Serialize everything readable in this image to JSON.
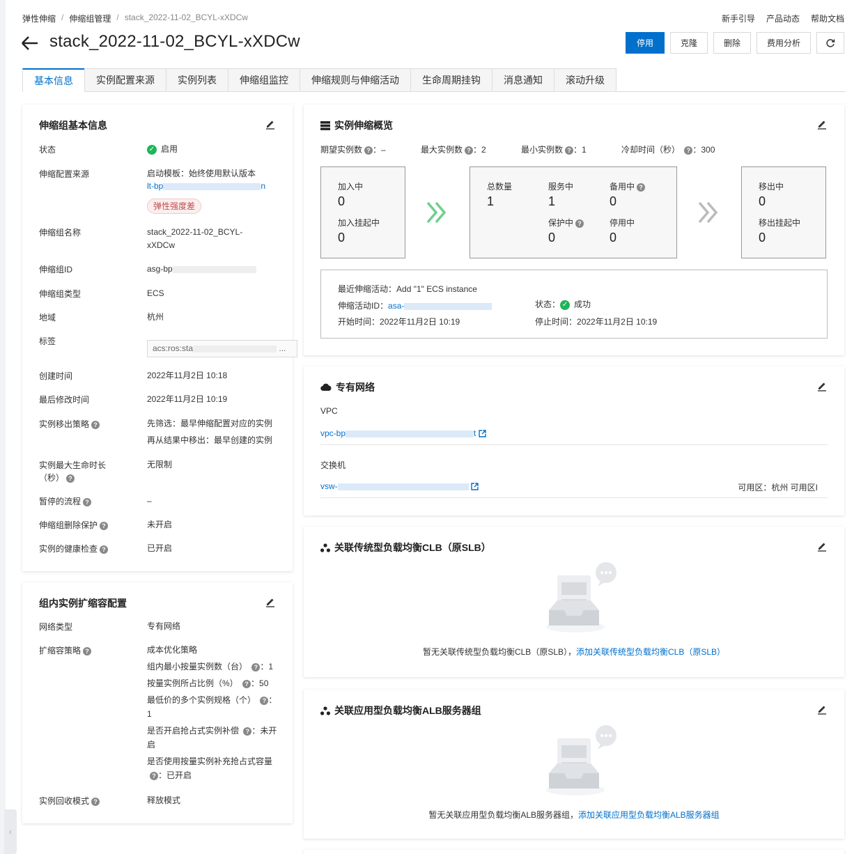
{
  "breadcrumb": {
    "items": [
      "弹性伸缩",
      "伸缩组管理",
      "stack_2022-11-02_BCYL-xXDCw"
    ]
  },
  "top_links": [
    "新手引导",
    "产品动态",
    "帮助文档"
  ],
  "page": {
    "title": "stack_2022-11-02_BCYL-xXDCw"
  },
  "actions": {
    "disable": "停用",
    "clone": "克隆",
    "delete": "删除",
    "cost": "费用分析"
  },
  "tabs": [
    "基本信息",
    "实例配置来源",
    "实例列表",
    "伸缩组监控",
    "伸缩规则与伸缩活动",
    "生命周期挂钩",
    "消息通知",
    "滚动升级"
  ],
  "basic": {
    "title": "伸缩组基本信息",
    "status_label": "状态",
    "status_value": "启用",
    "source_label": "伸缩配置来源",
    "source_value": "启动模板：始终使用默认版本",
    "source_link": "lt-bp",
    "source_link_tail": "n",
    "source_badge": "弹性强度差",
    "name_label": "伸缩组名称",
    "name_value_1": "stack_2022-11-02_BCYL-",
    "name_value_2": "xXDCw",
    "id_label": "伸缩组ID",
    "id_value": "asg-bp",
    "type_label": "伸缩组类型",
    "type_value": "ECS",
    "region_label": "地域",
    "region_value": "杭州",
    "tag_label": "标签",
    "tag_value": "acs:ros:sta",
    "created_label": "创建时间",
    "created_value": "2022年11月2日 10:18",
    "modified_label": "最后修改时间",
    "modified_value": "2022年11月2日 10:19",
    "removal_label": "实例移出策略",
    "removal_value_1": "先筛选：最早伸缩配置对应的实例",
    "removal_value_2": "再从结果中移出：最早创建的实例",
    "lifetime_label_1": "实例最大生命时长",
    "lifetime_label_2": "（秒）",
    "lifetime_value": "无限制",
    "paused_label": "暂停的流程",
    "paused_value": "–",
    "protect_label": "伸缩组删除保护",
    "protect_value": "未开启",
    "health_label": "实例的健康检查",
    "health_value": "已开启"
  },
  "scaling_config": {
    "title": "组内实例扩缩容配置",
    "network_label": "网络类型",
    "network_value": "专有网络",
    "strategy_label": "扩缩容策略",
    "strategy_value": "成本优化策略",
    "lines": [
      "组内最小按量实例数（台）",
      "：1",
      "按量实例所占比例（%）",
      "：50",
      "最低价的多个实例规格（个）",
      "：",
      "1",
      "是否开启抢占式实例补偿",
      "：未开",
      "启",
      "是否使用按量实例补充抢占式容量",
      "：已开启"
    ],
    "recycle_label": "实例回收模式",
    "recycle_value": "释放模式"
  },
  "overview": {
    "title": "实例伸缩概览",
    "desired_label": "期望实例数",
    "desired_value": "–",
    "max_label": "最大实例数",
    "max_value": "2",
    "min_label": "最小实例数",
    "min_value": "1",
    "cooldown_label": "冷却时间（秒）",
    "cooldown_value": "300",
    "adding_label": "加入中",
    "adding_value": "0",
    "adding_hook_label": "加入挂起中",
    "adding_hook_value": "0",
    "total_label": "总数量",
    "total_value": "1",
    "inservice_label": "服务中",
    "inservice_value": "1",
    "standby_label": "备用中",
    "standby_value": "0",
    "protected_label": "保护中",
    "protected_value": "0",
    "stopped_label": "停用中",
    "stopped_value": "0",
    "removing_label": "移出中",
    "removing_value": "0",
    "removing_hook_label": "移出挂起中",
    "removing_hook_value": "0",
    "activity_label": "最近伸缩活动：",
    "activity_value": "Add \"1\" ECS instance",
    "activity_id_label": "伸缩活动ID：",
    "activity_id_value": "asa-",
    "activity_status_label": "状态：",
    "activity_status_value": "成功",
    "start_label": "开始时间：",
    "start_value": "2022年11月2日 10:19",
    "end_label": "停止时间：",
    "end_value": "2022年11月2日 10:19"
  },
  "vpc": {
    "title": "专有网络",
    "vpc_label": "VPC",
    "vpc_value": "vpc-bp",
    "vpc_tail": "t",
    "vsw_label": "交换机",
    "vsw_value": "vsw-",
    "zone_label": "可用区：",
    "zone_value": "杭州 可用区I"
  },
  "clb": {
    "title": "关联传统型负载均衡CLB（原SLB）",
    "empty": "暂无关联传统型负载均衡CLB（原SLB），",
    "add": "添加关联传统型负载均衡CLB（原SLB）"
  },
  "alb": {
    "title": "关联应用型负载均衡ALB服务器组",
    "empty": "暂无关联应用型负载均衡ALB服务器组，",
    "add": "添加关联应用型负载均衡ALB服务器组"
  }
}
